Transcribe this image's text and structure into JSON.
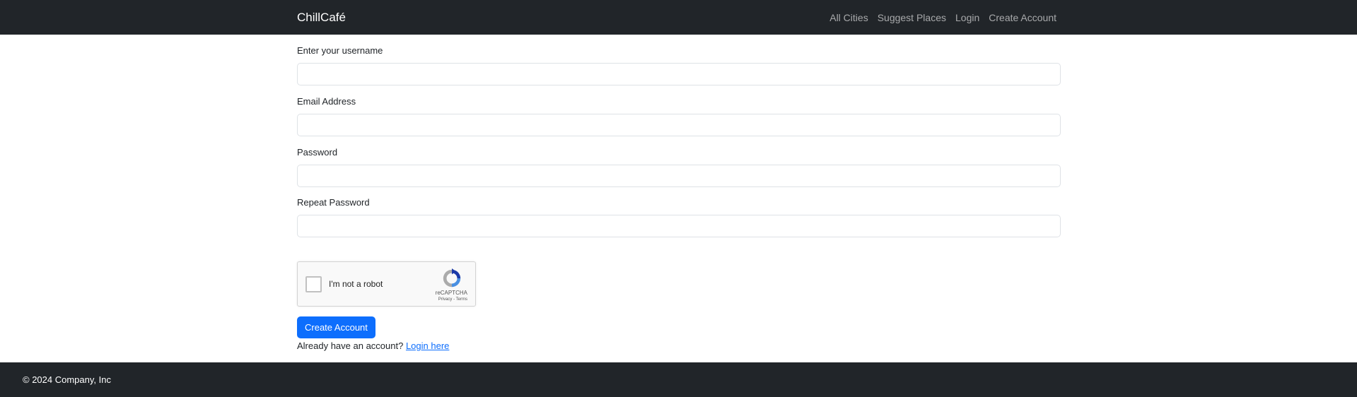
{
  "navbar": {
    "brand": "ChillCafé",
    "links": [
      "All Cities",
      "Suggest Places",
      "Login",
      "Create Account"
    ]
  },
  "form": {
    "username_label": "Enter your username",
    "username_value": "",
    "email_label": "Email Address",
    "email_value": "",
    "password_label": "Password",
    "password_value": "",
    "repeat_password_label": "Repeat Password",
    "repeat_password_value": "",
    "submit_label": "Create Account",
    "login_prompt": "Already have an account?",
    "login_link": "Login here"
  },
  "recaptcha": {
    "label": "I'm not a robot",
    "brand": "reCAPTCHA",
    "privacy": "Privacy",
    "separator": "-",
    "terms": "Terms",
    "icon": "recaptcha-icon",
    "checked": false
  },
  "footer": {
    "copyright": "© 2024 Company, Inc"
  },
  "colors": {
    "navbar_bg": "#212529",
    "primary": "#0d6efd",
    "link": "#0d6efd"
  }
}
